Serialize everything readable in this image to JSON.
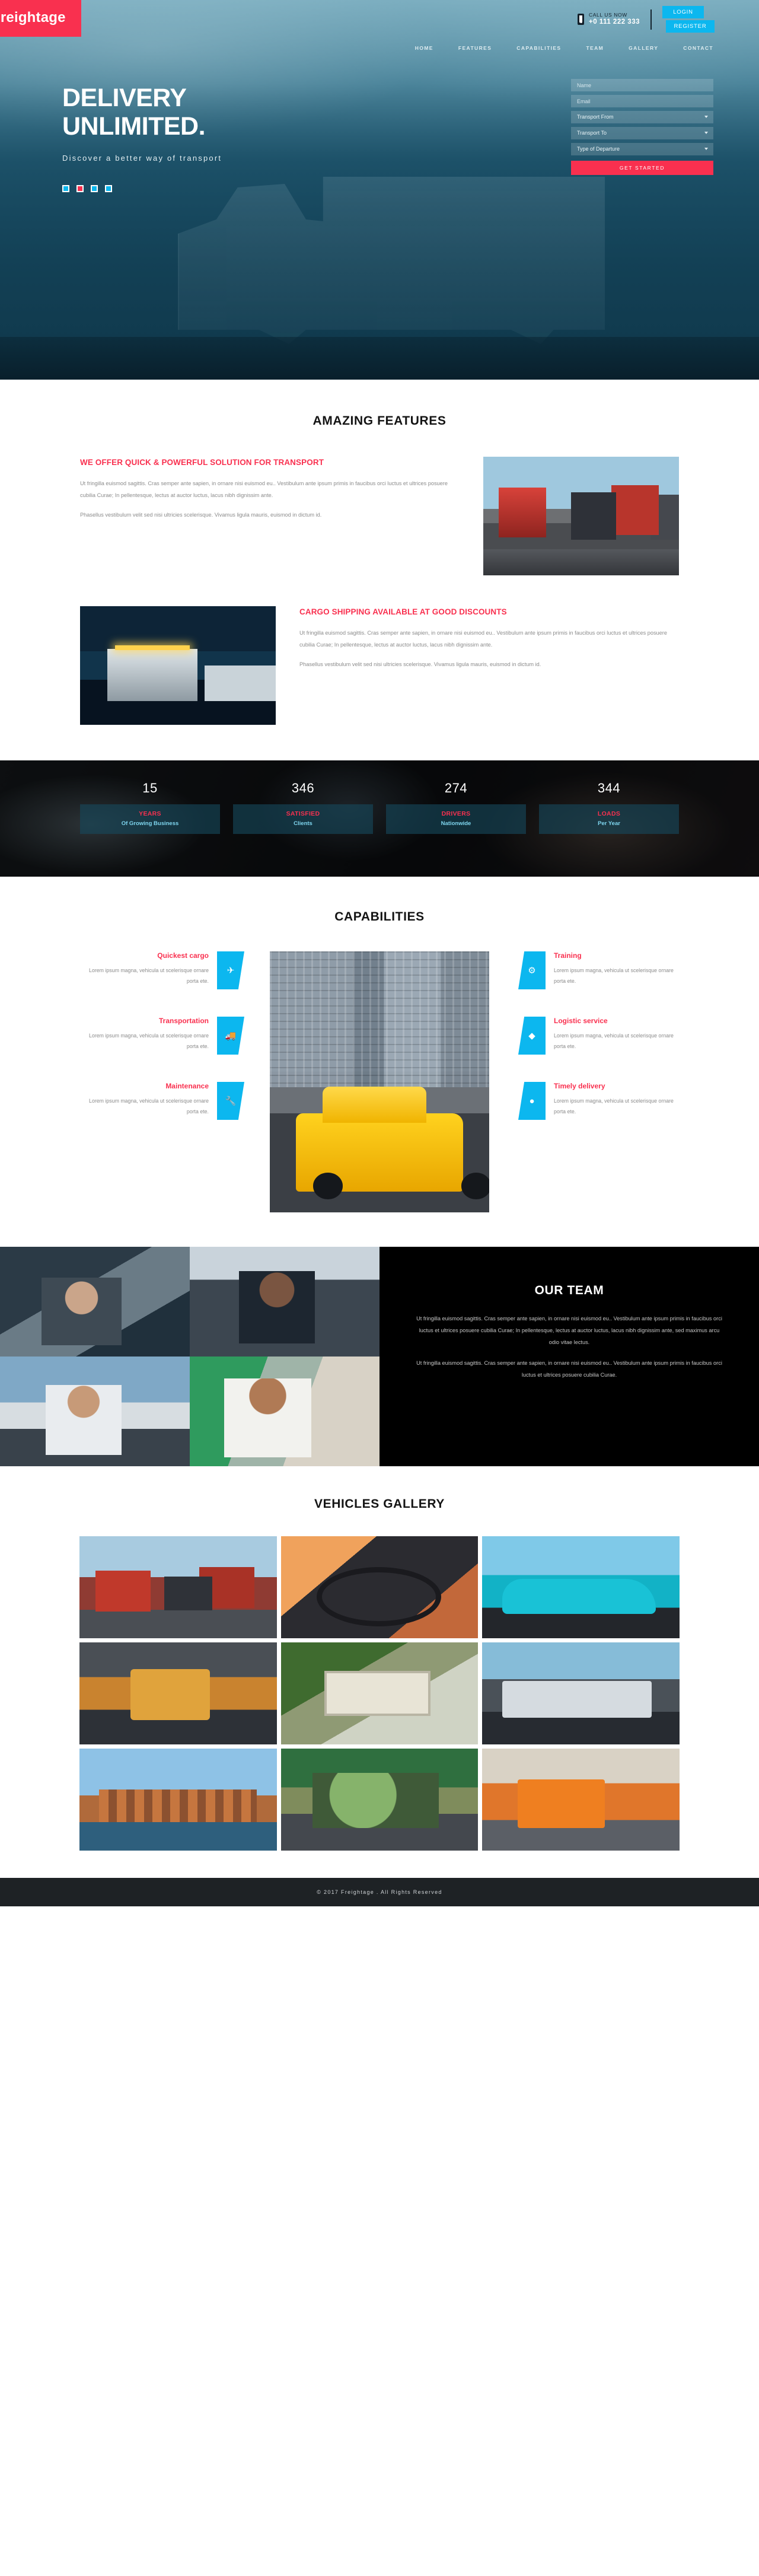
{
  "brand": {
    "name": "Freightage"
  },
  "topbar": {
    "call_label": "CALL US NOW",
    "phone": "+0 111 222 333",
    "login": "LOGIN",
    "register": "REGISTER",
    "phone_icon": "mobile-phone-icon",
    "accent_blue": "#0cb7ef",
    "accent_red": "#f9304f"
  },
  "nav": {
    "items": [
      {
        "label": "HOME"
      },
      {
        "label": "FEATURES"
      },
      {
        "label": "CAPABILITIES"
      },
      {
        "label": "TEAM"
      },
      {
        "label": "GALLERY"
      },
      {
        "label": "CONTACT"
      }
    ]
  },
  "hero": {
    "title_line1": "DELIVERY",
    "title_line2": "UNLIMITED.",
    "subtitle": "Discover a better way of transport",
    "socials": [
      {
        "name": "facebook-icon",
        "color": "#0cb7ef"
      },
      {
        "name": "google-plus-icon",
        "color": "#f9304f"
      },
      {
        "name": "twitter-icon",
        "color": "#0cb7ef"
      },
      {
        "name": "linkedin-icon",
        "color": "#0cb7ef"
      }
    ],
    "form": {
      "name_placeholder": "Name",
      "email_placeholder": "Email",
      "transport_from": "Transport From",
      "transport_to": "Transport To",
      "type_of_departure": "Type of Departure",
      "submit": "GET STARTED"
    }
  },
  "features": {
    "title": "AMAZING FEATURES",
    "blocks": [
      {
        "heading": "WE OFFER QUICK & POWERFUL SOLUTION FOR TRANSPORT",
        "p1": "Ut fringilla euismod sagittis. Cras semper ante sapien, in ornare nisi euismod eu.. Vestibulum ante ipsum primis in faucibus orci luctus et ultrices posuere cubilia Curae; In pellentesque, lectus at auctor luctus, lacus nibh dignissim ante.",
        "p2": "Phasellus vestibulum velit sed nisi ultricies scelerisque. Vivamus ligula mauris, euismod in dictum id.",
        "image": "red-trucks-lineup-photo"
      },
      {
        "heading": "CARGO SHIPPING AVAILABLE AT GOOD DISCOUNTS",
        "p1": "Ut fringilla euismod sagittis. Cras semper ante sapien, in ornare nisi euismod eu.. Vestibulum ante ipsum primis in faucibus orci luctus et ultrices posuere cubilia Curae; In pellentesque, lectus at auctor luctus, lacus nibh dignissim ante.",
        "p2": "Phasellus vestibulum velit sed nisi ultricies scelerisque. Vivamus ligula mauris, euismod in dictum id.",
        "image": "night-truck-photo"
      }
    ]
  },
  "stats": [
    {
      "number": "15",
      "title": "YEARS",
      "sub": "Of Growing Business"
    },
    {
      "number": "346",
      "title": "SATISFIED",
      "sub": "Clients"
    },
    {
      "number": "274",
      "title": "DRIVERS",
      "sub": "Nationwide"
    },
    {
      "number": "344",
      "title": "LOADS",
      "sub": "Per Year"
    }
  ],
  "capabilities": {
    "title": "CAPABILITIES",
    "body": "Lorem ipsum magna, vehicula ut scelerisque ornare porta ete.",
    "left": [
      {
        "heading": "Quickest cargo",
        "icon": "airplane-icon",
        "glyph": "✈"
      },
      {
        "heading": "Transportation",
        "icon": "truck-icon",
        "glyph": "🚚"
      },
      {
        "heading": "Maintenance",
        "icon": "wrench-icon",
        "glyph": "🔧"
      }
    ],
    "right": [
      {
        "heading": "Training",
        "icon": "gears-icon",
        "glyph": "⚙"
      },
      {
        "heading": "Logistic service",
        "icon": "droplet-icon",
        "glyph": "◆"
      },
      {
        "heading": "Timely delivery",
        "icon": "clock-icon",
        "glyph": "●"
      }
    ],
    "photo": "yellow-taxi-city-street-photo"
  },
  "team": {
    "title": "OUR TEAM",
    "p1": "Ut fringilla euismod sagittis. Cras semper ante sapien, in ornare nisi euismod eu.. Vestibulum ante ipsum primis in faucibus orci luctus et ultrices posuere cubilia Curae; In pellentesque, lectus at auctor luctus, lacus nibh dignissim ante, sed maximus arcu odio vitae lectus.",
    "p2": "Ut fringilla euismod sagittis. Cras semper ante sapien, in ornare nisi euismod eu.. Vestibulum ante ipsum primis in faucibus orci luctus et ultrices posuere cubilia Curae.",
    "photos": [
      "driver-sunglasses-photo",
      "driver-in-cab-photo",
      "driver-by-van-photo",
      "worker-bandana-photo"
    ]
  },
  "gallery": {
    "title": "VEHICLES GALLERY",
    "items": [
      "red-semi-trucks-photo",
      "steering-wheel-photo",
      "teal-sports-car-photo",
      "forklift-warehouse-photo",
      "aerial-industrial-park-photo",
      "car-carrier-truck-photo",
      "harbour-houses-photo",
      "aerial-green-field-photo",
      "orange-forklift-photo"
    ]
  },
  "footer": {
    "copyright": "© 2017 Freightage . All Rights Reserved"
  }
}
